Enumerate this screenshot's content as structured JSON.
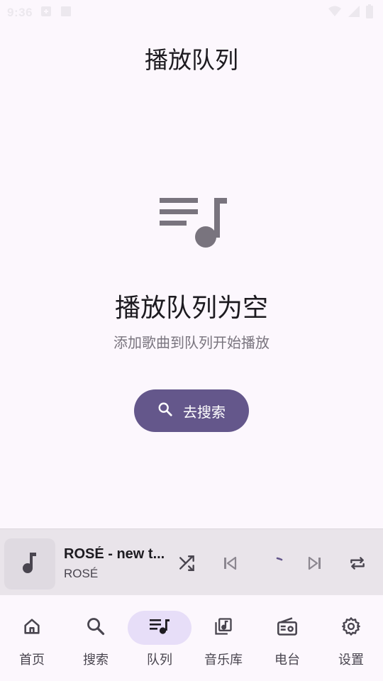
{
  "status_bar": {
    "time": "9:36"
  },
  "header": {
    "title": "播放队列"
  },
  "empty_state": {
    "title": "播放队列为空",
    "subtitle": "添加歌曲到队列开始播放",
    "button_label": "去搜索",
    "icon": "queue-music-icon"
  },
  "mini_player": {
    "title": "ROSÉ - new t...",
    "artist": "ROSÉ",
    "controls": [
      "shuffle-icon",
      "skip-previous-icon",
      "loading-spinner",
      "skip-next-icon",
      "repeat-icon"
    ]
  },
  "bottom_nav": {
    "items": [
      {
        "label": "首页",
        "icon": "home-icon"
      },
      {
        "label": "搜索",
        "icon": "search-icon"
      },
      {
        "label": "队列",
        "icon": "queue-music-icon",
        "active": true
      },
      {
        "label": "音乐库",
        "icon": "library-music-icon"
      },
      {
        "label": "电台",
        "icon": "radio-icon"
      },
      {
        "label": "设置",
        "icon": "settings-icon"
      }
    ]
  },
  "colors": {
    "background": "#fcf7fd",
    "accent": "#64578b",
    "active_pill": "#e7def8",
    "mini_player_bg": "#e9e4ea"
  }
}
